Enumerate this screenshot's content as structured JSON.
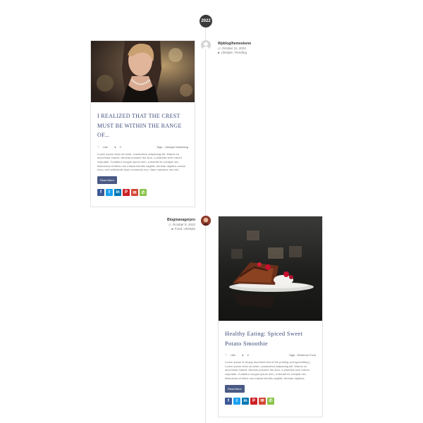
{
  "timeline": {
    "year": "2022"
  },
  "posts": [
    {
      "author": "Wpbloglhemeskeno",
      "date": "October 11, 2022",
      "categories": "Lifestyle, Trending",
      "title": "I REALIZED THAT THE CREST MUST BE WITHIN THE RANGE OF...",
      "like_label": "Like",
      "comments": "0",
      "tags_label": "Tags :",
      "tags": "Lifestyle Marketing",
      "excerpt": "Lorem ipsum dolor sit amet, consectetur adipiscing elit. Mauris eu accumsan mauris. Aenean posuere dui arcu, a pharetra sem rutrum vulputate. Curabitur congue ipsum sem, a blandit mi volutpat nec. Maecenas et tellus non massa lobortis sagittis. Aenean dapibus ornare risus, sed sollicitudin risus commodo non. Nam maximus nisi nisl.",
      "read_more": "Read More"
    },
    {
      "author": "Blogmanagerpro",
      "date": "October 8, 2022",
      "categories": "Food, Lifestyle",
      "title": "Healthy Eating: Spiced Sweet Potato Smoothie",
      "like_label": "Like",
      "comments": "0",
      "tags_label": "Tags :",
      "tags": "Delicious Food",
      "excerpt": "Lorem Ipsum is simply dummied text of the printing and typesetting ( Lorem ipsum dolor sit amet, consectetur adipiscing elit. Mauris eu accumsan mauris. Aenean posuere dui arcu, a pharetra sem rutrum vulputate. Curabitur congue ipsum sem, a blandit mi volutpat nec. Maecenas et tellus non massa lobortis sagittis. Aenean dapibus.",
      "read_more": "Read More"
    }
  ],
  "share_icons": [
    {
      "name": "facebook-icon",
      "glyph": "f",
      "color": "#3b5998"
    },
    {
      "name": "twitter-icon",
      "glyph": "t",
      "color": "#1da1f2"
    },
    {
      "name": "linkedin-icon",
      "glyph": "in",
      "color": "#0077b5"
    },
    {
      "name": "pinterest-icon",
      "glyph": "P",
      "color": "#cb2027"
    },
    {
      "name": "email-icon",
      "glyph": "✉",
      "color": "#d34836"
    },
    {
      "name": "whatsapp-icon",
      "glyph": "✆",
      "color": "#8bc34a"
    }
  ]
}
